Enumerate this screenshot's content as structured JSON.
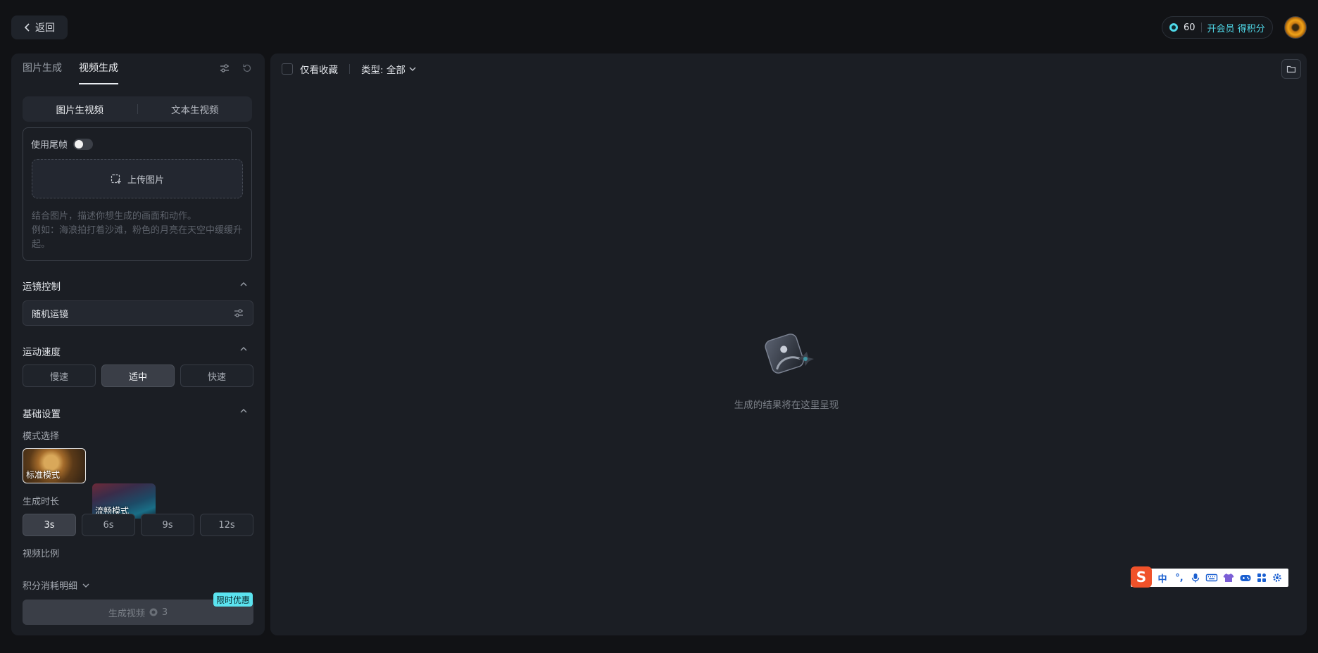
{
  "header": {
    "back_label": "返回",
    "points_value": "60",
    "member_label": "开会员 得积分"
  },
  "left": {
    "tabs": [
      {
        "label": "图片生成"
      },
      {
        "label": "视频生成",
        "active": true
      }
    ],
    "sub_tabs": [
      {
        "label": "图片生视频",
        "active": true
      },
      {
        "label": "文本生视频"
      }
    ],
    "tail_frame_label": "使用尾帧",
    "upload_label": "上传图片",
    "prompt_placeholder_line1": "结合图片，描述你想生成的画面和动作。",
    "prompt_placeholder_line2": "例如：海浪拍打着沙滩，粉色的月亮在天空中缓缓升起。",
    "camera": {
      "title": "运镜控制",
      "value": "随机运镜"
    },
    "speed": {
      "title": "运动速度",
      "options": [
        {
          "label": "慢速"
        },
        {
          "label": "适中",
          "active": true
        },
        {
          "label": "快速"
        }
      ]
    },
    "basic": {
      "title": "基础设置",
      "mode_label": "模式选择",
      "modes": [
        {
          "label": "标准模式",
          "active": true
        },
        {
          "label": "流畅模式"
        }
      ],
      "duration_label": "生成时长",
      "durations": [
        {
          "label": "3s",
          "active": true
        },
        {
          "label": "6s"
        },
        {
          "label": "9s"
        },
        {
          "label": "12s"
        }
      ],
      "ratio_label": "视频比例"
    },
    "cost_detail_label": "积分消耗明细",
    "generate_label": "生成视频",
    "generate_cost": "3",
    "promo_badge": "限时优惠"
  },
  "main": {
    "favorites_label": "仅看收藏",
    "type_filter_label": "类型: 全部",
    "empty_text": "生成的结果将在这里呈现"
  },
  "ime": {
    "logo": "S",
    "items": [
      "中",
      "°,",
      "mic-icon",
      "keyboard-icon",
      "shirt-icon",
      "gamepad-icon",
      "apps-icon",
      "gear-icon"
    ],
    "chinese_label": "中",
    "punct_label": "°,"
  },
  "colors": {
    "accent": "#4fd8e8",
    "background": "#111215",
    "panel": "#1b1e24",
    "ime_brand": "#f0522a"
  }
}
